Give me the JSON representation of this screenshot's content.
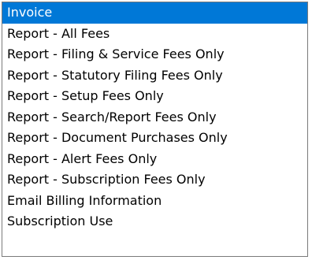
{
  "dropdown": {
    "selected_index": 0,
    "selection_color": "#0078d7",
    "options": [
      {
        "label": "Invoice"
      },
      {
        "label": "Report - All Fees"
      },
      {
        "label": "Report - Filing & Service Fees Only"
      },
      {
        "label": "Report - Statutory Filing Fees Only"
      },
      {
        "label": "Report - Setup Fees Only"
      },
      {
        "label": "Report - Search/Report Fees Only"
      },
      {
        "label": "Report - Document Purchases Only"
      },
      {
        "label": "Report - Alert Fees Only"
      },
      {
        "label": "Report - Subscription Fees Only"
      },
      {
        "label": "Email Billing Information"
      },
      {
        "label": "Subscription Use"
      }
    ]
  }
}
